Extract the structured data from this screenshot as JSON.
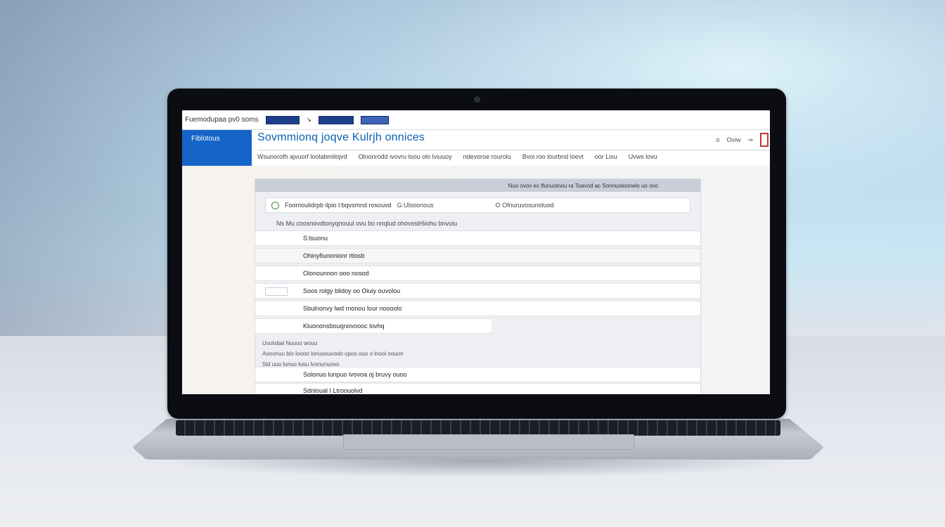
{
  "app": {
    "brand": "Fuemodupaa pv0 soms",
    "title": "Sovmmionq joqve Kulrjh onnices",
    "side_tab": "Fiblotous",
    "header_controls": [
      "o",
      "Oviw",
      "⇒"
    ],
    "subnav": [
      "Wsunorofh ajvuorf loolabmilojvd",
      "Olnonrodd ivovru loou olo lviuuoy",
      "ndevoroe rourolu",
      "Bvoi roo lourbnd loevt",
      "oor Lixu",
      "Uvws lovu"
    ]
  },
  "panel": {
    "header": "Nuo  ovov ec lfunuolnou ra Toavod ac Sonnuoloonelo uo ovo",
    "filter": {
      "option1": "Foomoulidrpb ilpio l:bqvsmnd rosouvd",
      "option2": "G:Ulsoonous",
      "option3": "O Ofnuruvosunoluod"
    },
    "note": "Ns  Mu coosnovdlonyqnouul ovu bo nnqlud ohovoslr6iohu bnvoiu",
    "rows": [
      "S:lsuonu",
      "Ohinyfiunonionr rtiosb",
      "Olonounnon ooo nosod",
      "Soos rolgy blidoy oo Oiuiy ouvolou",
      "Sbulnonvy lwd rnonou lour noooolo",
      "Kluononsbouqnovoooc lovhq"
    ],
    "group_lines": [
      "Usolobal   Nuuuo   wouu",
      "Aooonuu   blo   loooo   lonuoouvodo opoo   ouo   o lnool nouon",
      "Sld uuo   lunuo   luou lvonunuovo"
    ],
    "rows2": [
      "Solonuo lunpuo lvovoa   oj bruvy ouoo",
      "Sdnloual   I   Ltroouolvd"
    ]
  },
  "colors": {
    "accent": "#1565c8",
    "title": "#0d5fb3"
  }
}
